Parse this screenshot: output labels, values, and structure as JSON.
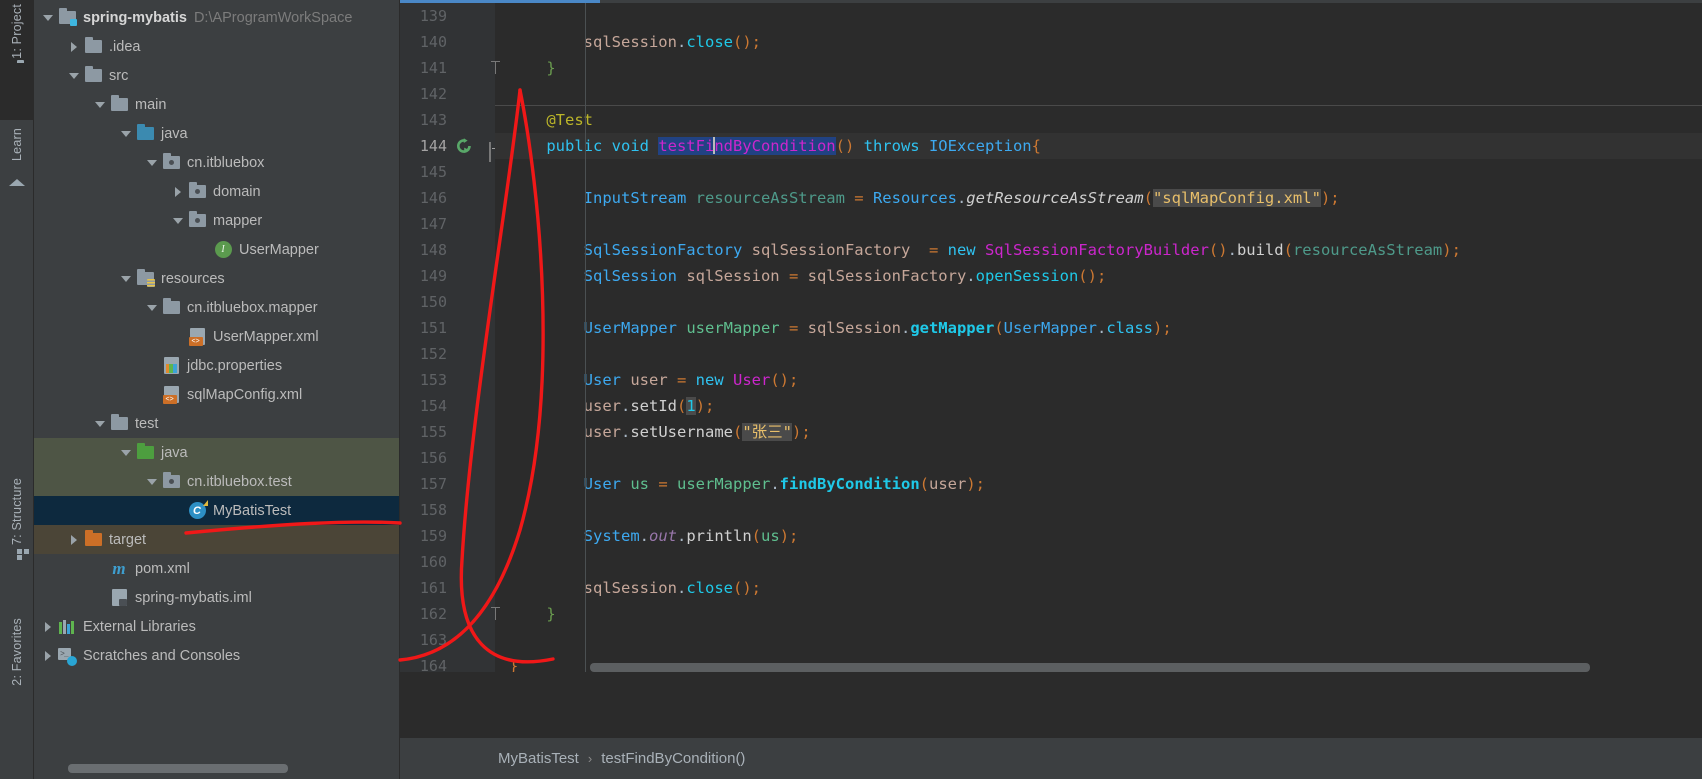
{
  "toolstrip": {
    "tabs": [
      {
        "name": "project",
        "label": "1: Project",
        "icon": "folder-icon",
        "active": true
      },
      {
        "name": "learn",
        "label": "Learn",
        "icon": "learn-icon",
        "active": false
      },
      {
        "name": "structure",
        "label": "7: Structure",
        "icon": "structure-icon",
        "active": false
      },
      {
        "name": "favorites",
        "label": "2: Favorites",
        "icon": "favorites-icon",
        "active": false
      }
    ]
  },
  "project_tree": {
    "root_label": "spring-mybatis",
    "root_path": "D:\\AProgramWorkSpace",
    "items": [
      {
        "label": ".idea",
        "indent": 1,
        "arrow": "right",
        "icon": "folder-gray",
        "state": "none"
      },
      {
        "label": "src",
        "indent": 1,
        "arrow": "down",
        "icon": "folder-gray",
        "state": "none"
      },
      {
        "label": "main",
        "indent": 2,
        "arrow": "down",
        "icon": "folder-gray",
        "state": "none"
      },
      {
        "label": "java",
        "indent": 3,
        "arrow": "down",
        "icon": "folder-source-blue",
        "state": "none"
      },
      {
        "label": "cn.itbluebox",
        "indent": 4,
        "arrow": "down",
        "icon": "package",
        "state": "none"
      },
      {
        "label": "domain",
        "indent": 5,
        "arrow": "right",
        "icon": "package",
        "state": "none"
      },
      {
        "label": "mapper",
        "indent": 5,
        "arrow": "down",
        "icon": "package",
        "state": "none"
      },
      {
        "label": "UserMapper",
        "indent": 6,
        "arrow": "none",
        "icon": "interface",
        "state": "none"
      },
      {
        "label": "resources",
        "indent": 3,
        "arrow": "down",
        "icon": "folder-resources",
        "state": "none"
      },
      {
        "label": "cn.itbluebox.mapper",
        "indent": 4,
        "arrow": "down",
        "icon": "folder-gray",
        "state": "none"
      },
      {
        "label": "UserMapper.xml",
        "indent": 5,
        "arrow": "none",
        "icon": "xml-file",
        "state": "none"
      },
      {
        "label": "jdbc.properties",
        "indent": 4,
        "arrow": "none",
        "icon": "properties-file",
        "state": "none"
      },
      {
        "label": "sqlMapConfig.xml",
        "indent": 4,
        "arrow": "none",
        "icon": "xml-file",
        "state": "none"
      },
      {
        "label": "test",
        "indent": 2,
        "arrow": "down",
        "icon": "folder-gray",
        "state": "none"
      },
      {
        "label": "java",
        "indent": 3,
        "arrow": "down",
        "icon": "folder-test-green",
        "state": "green"
      },
      {
        "label": "cn.itbluebox.test",
        "indent": 4,
        "arrow": "down",
        "icon": "package",
        "state": "green"
      },
      {
        "label": "MyBatisTest",
        "indent": 5,
        "arrow": "none",
        "icon": "class-run",
        "state": "blue"
      },
      {
        "label": "target",
        "indent": 1,
        "arrow": "right",
        "icon": "folder-orange",
        "state": "target"
      },
      {
        "label": "pom.xml",
        "indent": 2,
        "arrow": "none",
        "icon": "maven-file",
        "state": "none"
      },
      {
        "label": "spring-mybatis.iml",
        "indent": 2,
        "arrow": "none",
        "icon": "iml-file",
        "state": "none"
      },
      {
        "label": "External Libraries",
        "indent": 0,
        "arrow": "right",
        "icon": "external-libraries",
        "state": "none"
      },
      {
        "label": "Scratches and Consoles",
        "indent": 0,
        "arrow": "right",
        "icon": "scratches",
        "state": "none"
      }
    ]
  },
  "editor": {
    "first_line": 139,
    "current_line": 144,
    "lines": [
      {
        "n": 139,
        "fold": "none"
      },
      {
        "n": 140,
        "fold": "none"
      },
      {
        "n": 141,
        "fold": "end"
      },
      {
        "n": 142,
        "fold": "none"
      },
      {
        "n": 143,
        "fold": "none"
      },
      {
        "n": 144,
        "fold": "box",
        "run": true,
        "current": true
      },
      {
        "n": 145,
        "fold": "none"
      },
      {
        "n": 146,
        "fold": "none"
      },
      {
        "n": 147,
        "fold": "none"
      },
      {
        "n": 148,
        "fold": "none"
      },
      {
        "n": 149,
        "fold": "none"
      },
      {
        "n": 150,
        "fold": "none"
      },
      {
        "n": 151,
        "fold": "none"
      },
      {
        "n": 152,
        "fold": "none"
      },
      {
        "n": 153,
        "fold": "none"
      },
      {
        "n": 154,
        "fold": "none"
      },
      {
        "n": 155,
        "fold": "none"
      },
      {
        "n": 156,
        "fold": "none"
      },
      {
        "n": 157,
        "fold": "none"
      },
      {
        "n": 158,
        "fold": "none"
      },
      {
        "n": 159,
        "fold": "none"
      },
      {
        "n": 160,
        "fold": "none"
      },
      {
        "n": 161,
        "fold": "none"
      },
      {
        "n": 162,
        "fold": "end"
      },
      {
        "n": 163,
        "fold": "none"
      },
      {
        "n": 164,
        "fold": "none"
      }
    ],
    "code": [
      "",
      "        sqlSession.close();",
      "    }",
      "",
      "    @Test",
      "    public void testFindByCondition() throws IOException{",
      "",
      "        InputStream resourceAsStream = Resources.getResourceAsStream(\"sqlMapConfig.xml\");",
      "",
      "        SqlSessionFactory sqlSessionFactory  = new SqlSessionFactoryBuilder().build(resourceAsStream);",
      "        SqlSession sqlSession = sqlSessionFactory.openSession();",
      "",
      "        UserMapper userMapper = sqlSession.getMapper(UserMapper.class);",
      "",
      "        User user = new User();",
      "        user.setId(1);",
      "        user.setUsername(\"张三\");",
      "",
      "        User us = userMapper.findByCondition(user);",
      "",
      "        System.out.println(us);",
      "",
      "        sqlSession.close();",
      "    }",
      "",
      "}"
    ],
    "selected_text": "testFindByCondition",
    "highlighted_strings": [
      "\"sqlMapConfig.xml\"",
      "1",
      "\"张三\""
    ]
  },
  "breadcrumb": {
    "class": "MyBatisTest",
    "separator": "›",
    "method": "testFindByCondition()"
  },
  "colors": {
    "accent": "#4a88c7",
    "selection": "#214283",
    "editor_bg": "#2b2b2b",
    "panel_bg": "#3c3f41",
    "gutter_bg": "#313335",
    "annotation_red": "#f01818",
    "tree_select_blue": "#0d293e",
    "tree_select_green": "#4e5545"
  }
}
